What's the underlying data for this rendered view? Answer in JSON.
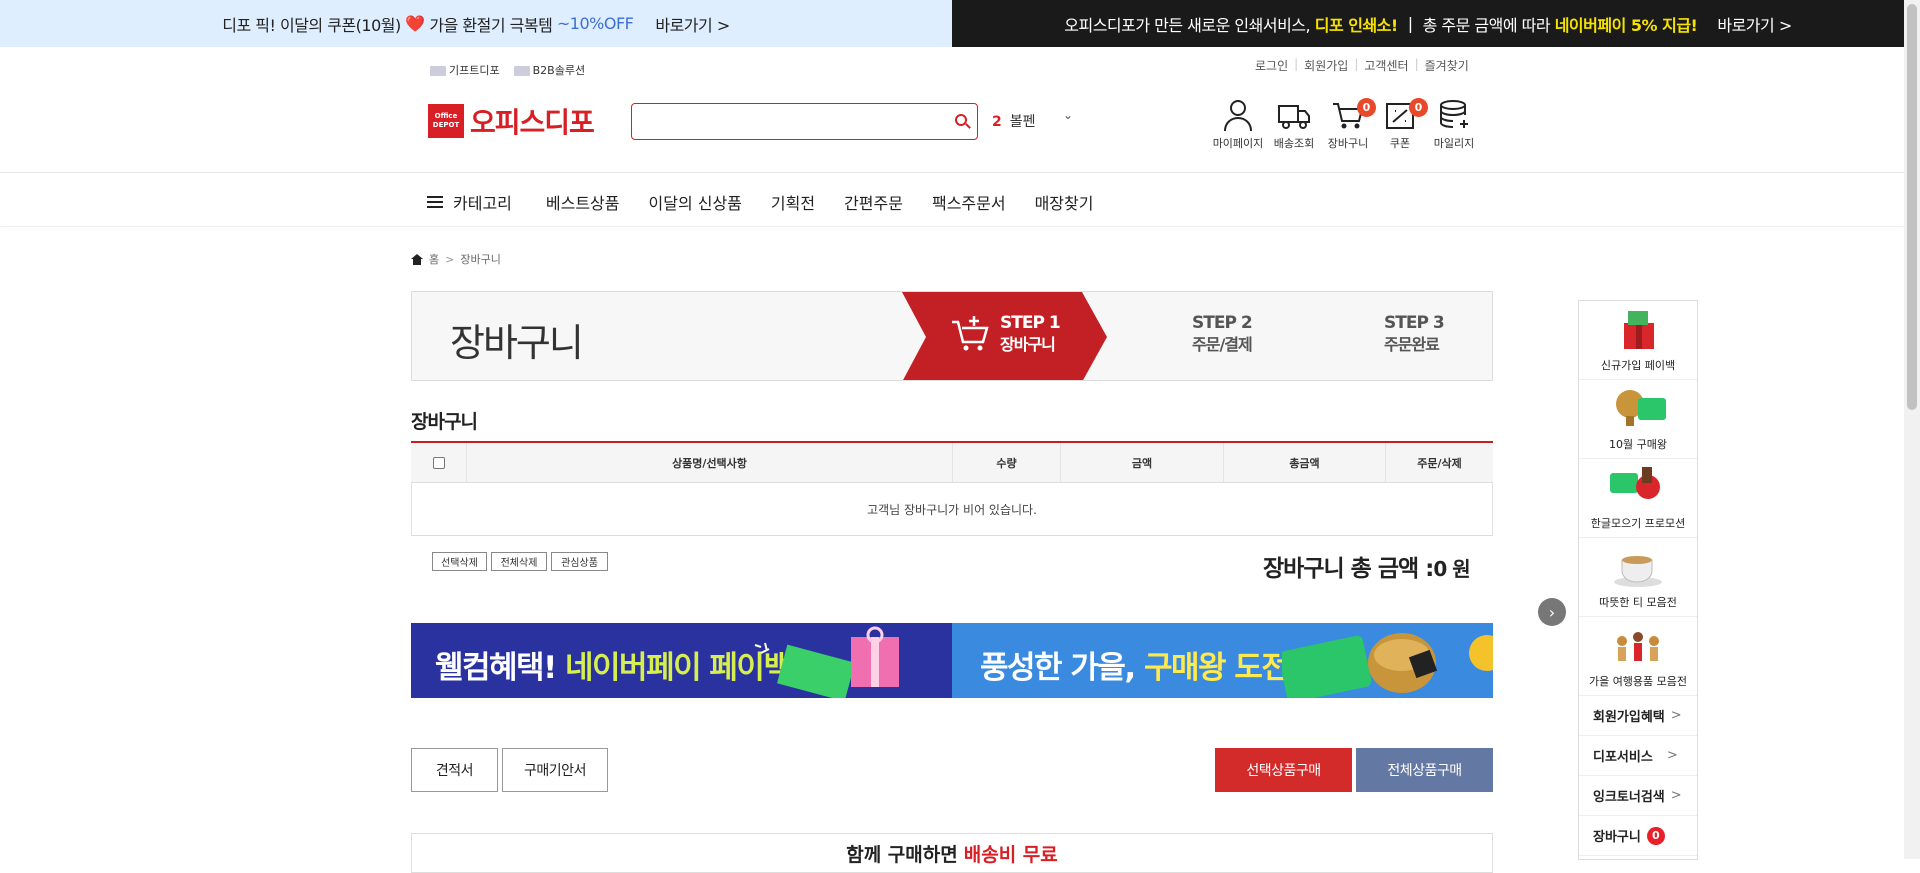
{
  "top_banner": {
    "left_text": "디포 픽! 이달의 쿠폰(10월)",
    "left_heart": "❤️",
    "left_text2": "가을 환절기 극복템",
    "left_discount": "~10%OFF",
    "left_go": "바로가기 >",
    "right_text": "오피스디포가 만든 새로운 인쇄서비스,",
    "right_highlight": "디포 인쇄소!",
    "right_sep": "|",
    "right_text2": "총 주문 금액에 따라",
    "right_highlight2": "네이버페이 5% 지급!",
    "right_go": "바로가기 >"
  },
  "util": {
    "left": [
      "기프트디포",
      "B2B솔루션"
    ],
    "right": [
      "로그인",
      "회원가입",
      "고객센터",
      "즐겨찾기"
    ]
  },
  "logo": {
    "box_top": "Office",
    "box_bottom": "DEPOT",
    "name": "오피스디포"
  },
  "search": {
    "value": "",
    "placeholder": ""
  },
  "rank": {
    "number": "2",
    "keyword": "볼펜",
    "chevron": "⌄"
  },
  "header_icons": [
    {
      "label": "마이페이지",
      "icon": "person-icon"
    },
    {
      "label": "배송조회",
      "icon": "truck-icon"
    },
    {
      "label": "장바구니",
      "icon": "cart-icon",
      "badge": "0"
    },
    {
      "label": "쿠폰",
      "icon": "coupon-icon",
      "badge": "0"
    },
    {
      "label": "마일리지",
      "icon": "coins-icon"
    }
  ],
  "gnb": {
    "category": "카테고리",
    "items": [
      "베스트상품",
      "이달의 신상품",
      "기획전",
      "간편주문",
      "팩스주문서",
      "매장찾기"
    ]
  },
  "breadcrumb": {
    "home": "홈",
    "sep": ">",
    "current": "장바구니"
  },
  "steps": {
    "title": "장바구니",
    "step1": {
      "num": "STEP 1",
      "label": "장바구니"
    },
    "step2": {
      "num": "STEP 2",
      "label": "주문/결제"
    },
    "step3": {
      "num": "STEP 3",
      "label": "주문완료"
    }
  },
  "cart": {
    "heading": "장바구니",
    "columns": [
      "상품명/선택사항",
      "수량",
      "금액",
      "총금액",
      "주문/삭제"
    ],
    "empty_message": "고객님 장바구니가 비어 있습니다.",
    "buttons": [
      "선택삭제",
      "전체삭제",
      "관심상품"
    ],
    "total_label": "장바구니 총 금액 :",
    "total_value": "0 원"
  },
  "banners": {
    "b1_white": "웰컴혜택!",
    "b1_green": "네이버페이 페이백",
    "b2_white": "풍성한 가을,",
    "b2_yellow": "구매왕 도전!"
  },
  "actions": {
    "estimate": "견적서",
    "guide": "구매기안서",
    "buy_selected": "선택상품구매",
    "buy_all": "전체상품구매"
  },
  "together": {
    "text": "함께 구매하면",
    "red": "배송비 무료"
  },
  "quick_menu": {
    "promos": [
      "신규가입 페이백",
      "10월 구매왕",
      "한글모으기 프로모션",
      "따뜻한 티 모음전",
      "가을 여행용품 모음전"
    ],
    "links": [
      "회원가입혜택",
      "디포서비스",
      "잉크토너검색"
    ],
    "cart_label": "장바구니",
    "cart_count": "0",
    "arrow": ">",
    "next": "›"
  },
  "colors": {
    "brand": "#d71f25",
    "step_active": "#c32026",
    "navy_button": "#6478a4"
  }
}
